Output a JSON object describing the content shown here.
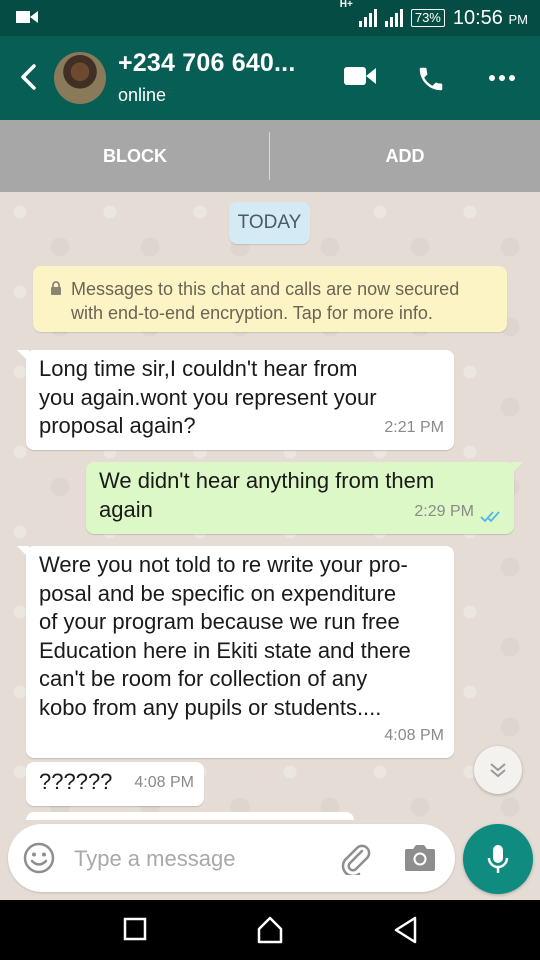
{
  "status_bar": {
    "network_label": "H+",
    "battery": "73%",
    "time": "10:56",
    "ampm": "PM"
  },
  "header": {
    "contact": "+234 706 640...",
    "status": "online"
  },
  "actions": {
    "block_label": "BLOCK",
    "add_label": "ADD"
  },
  "chat": {
    "date_chip": "TODAY",
    "encryption_notice": [
      "Messages to this chat and calls are now secured",
      "with end-to-end encryption. Tap for more info."
    ],
    "messages": [
      {
        "direction": "incoming",
        "lines": [
          "Long time sir,I couldn't hear from",
          "you again.wont you represent your",
          "proposal again?"
        ],
        "time": "2:21 PM"
      },
      {
        "direction": "outgoing",
        "lines": [
          "We didn't hear anything from them",
          "again"
        ],
        "time": "2:29 PM",
        "read_receipt": "double-check-blue"
      },
      {
        "direction": "incoming",
        "lines": [
          "Were you not told to re write your pro-",
          "posal and be specific on expenditure",
          "of your program because we run free",
          "Education here in Ekiti state and there",
          "can't be room for collection of any",
          "kobo from any pupils or students...."
        ],
        "time": "4:08 PM"
      },
      {
        "direction": "incoming",
        "lines": [
          "??????"
        ],
        "time": "4:08 PM"
      }
    ]
  },
  "composer": {
    "placeholder": "Type a message"
  },
  "icons": {
    "back": "arrow-back",
    "video_call": "video-camera",
    "voice_call": "phone",
    "menu": "more-vert",
    "lock": "lock",
    "scroll": "chevron-double-down",
    "emoji": "smiley",
    "attach": "paperclip",
    "camera": "camera",
    "mic": "microphone",
    "nav_recent": "square",
    "nav_home": "home",
    "nav_back": "triangle-back"
  },
  "colors": {
    "header": "#075e54",
    "statusbar": "#054d44",
    "outgoing_bubble": "#dcf8c6",
    "incoming_bubble": "#ffffff",
    "chat_background": "#e5ddd5",
    "notice_background": "#fcf4c4",
    "mic_button": "#0f8b7f",
    "read_tick": "#4fb6ec"
  }
}
